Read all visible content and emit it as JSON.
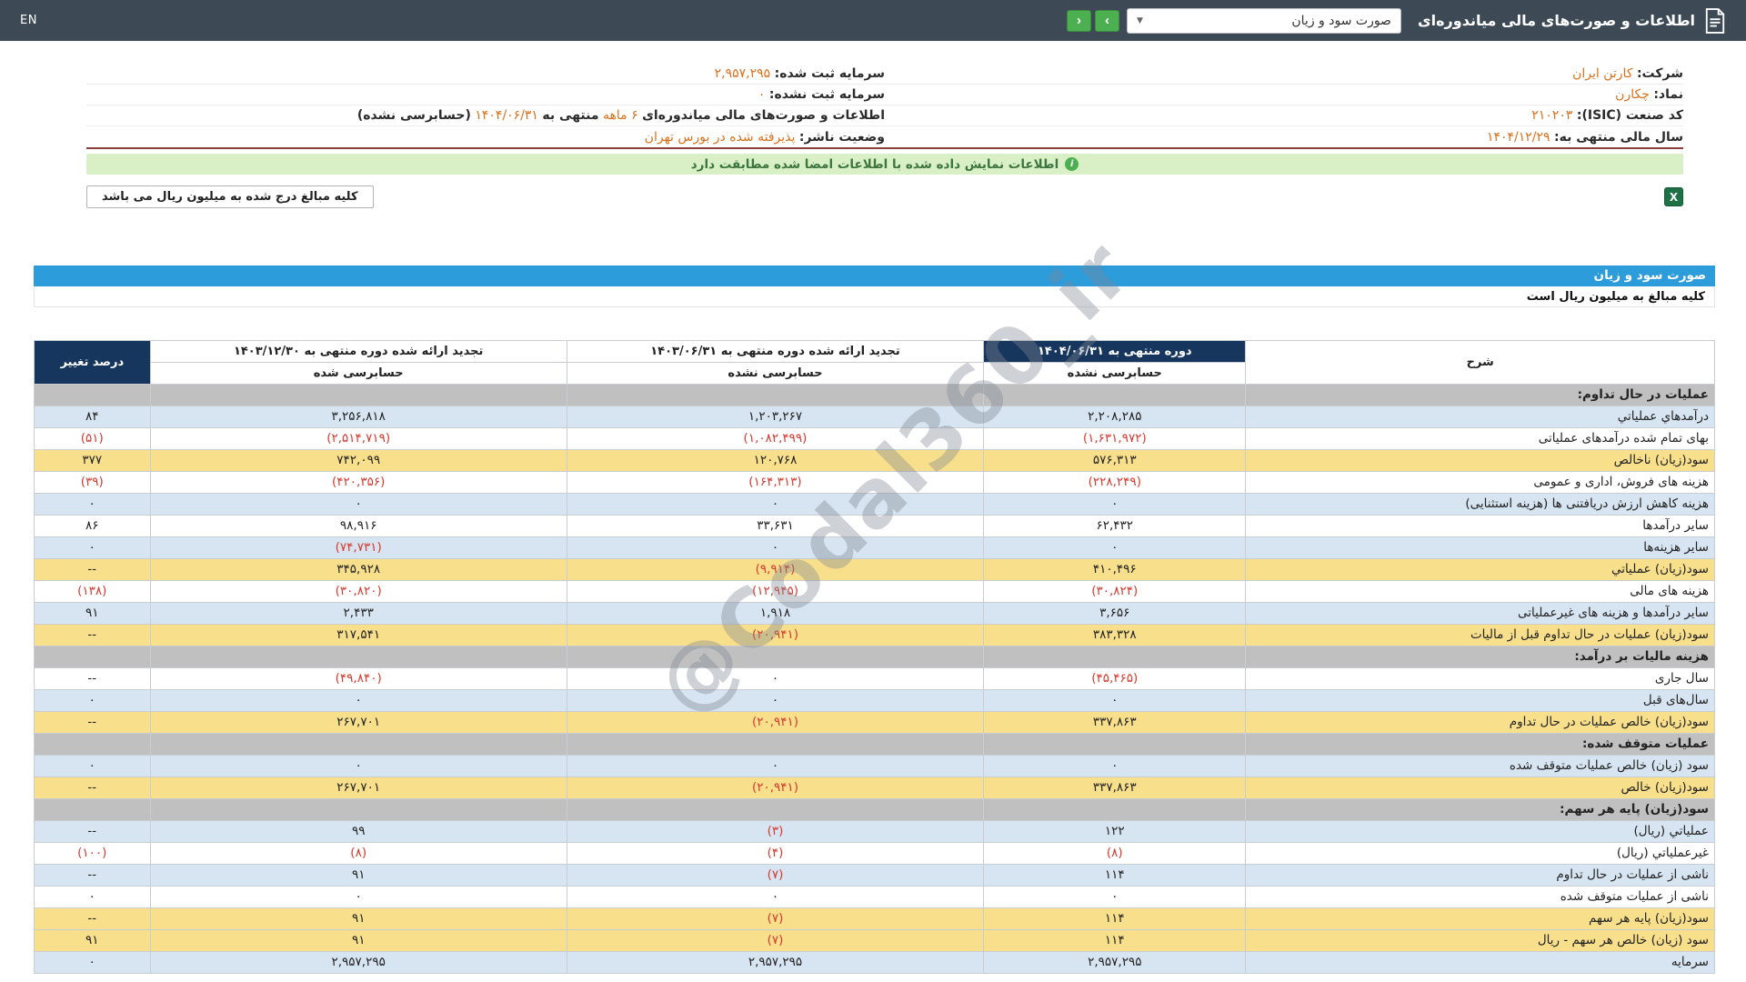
{
  "colors": {
    "topbar_bg": "#3d4a56",
    "accent_orange": "#d9711c",
    "nav_green": "#4caf50",
    "banner_bg": "#d9efc5",
    "banner_text": "#3c763d",
    "statement_bar_blue": "#2d9cdb",
    "header_navy": "#17365d",
    "row_blue": "#d7e4f1",
    "row_yellow": "#f8df8b",
    "section_gray": "#c0c0c0",
    "negative_red": "#d63a2f",
    "divider_red": "#8e3b3b",
    "excel_green": "#1e7145"
  },
  "topbar": {
    "title": "اطلاعات و صورت‌های مالی میاندوره‌ای",
    "dropdown_value": "صورت سود و زیان",
    "nav_forward": "›",
    "nav_back": "‹",
    "lang_label": "EN"
  },
  "icons": {
    "dropdown_caret": "▼",
    "info_icon": "i",
    "excel_letter": "X"
  },
  "company_info": {
    "company_label": "شرکت:",
    "company_value": "کارتن ایران",
    "registered_capital_label": "سرمایه ثبت شده:",
    "registered_capital_value": "۲,۹۵۷,۲۹۵",
    "symbol_label": "نماد:",
    "symbol_value": "چکارن",
    "unregistered_capital_label": "سرمایه ثبت نشده:",
    "unregistered_capital_value": "۰",
    "isic_label": "کد صنعت (ISIC):",
    "isic_value": "۲۱۰۲۰۳",
    "period_prefix": "اطلاعات و صورت‌های مالی میاندوره‌ای",
    "period_length": "۶ ماهه",
    "period_mid": "منتهی به",
    "period_date": "۱۴۰۴/۰۶/۳۱",
    "period_suffix": "(حسابرسی نشده)",
    "fiscal_year_label": "سال مالی منتهی به:",
    "fiscal_year_value": "۱۴۰۴/۱۲/۲۹",
    "publisher_status_label": "وضعیت ناشر:",
    "publisher_status_value": "پذیرفته شده در بورس تهران"
  },
  "banner": {
    "message": "اطلاعات نمایش داده شده با اطلاعات امضا شده مطابقت دارد"
  },
  "toolbar": {
    "unit_note": "کلیه مبالغ درج شده به میلیون ریال می باشد"
  },
  "statement": {
    "title": "صورت سود و زیان",
    "unit_note": "کلیه مبالغ به میلیون ریال است"
  },
  "watermark": "@Codal360_ir",
  "table": {
    "headers": {
      "col_desc": "شرح",
      "col_current": "دوره منتهی به ۱۴۰۴/۰۶/۳۱",
      "col_current_sub": "حسابرسی نشده",
      "col_prev_mid": "تجدید ارائه شده دوره منتهی به ۱۴۰۳/۰۶/۳۱",
      "col_prev_mid_sub": "حسابرسی نشده",
      "col_prev_year": "تجدید ارائه شده دوره منتهی به ۱۴۰۳/۱۲/۳۰",
      "col_prev_year_sub": "حسابرسی شده",
      "col_change": "درصد تغییر"
    },
    "rows": [
      {
        "type": "section",
        "label": "عملیات در حال تداوم:"
      },
      {
        "type": "data",
        "style": "blue",
        "label": "درآمدهاي عملياتي",
        "current": "۲,۲۰۸,۲۸۵",
        "prev_mid": "۱,۲۰۳,۲۶۷",
        "prev_year": "۳,۲۵۶,۸۱۸",
        "change": "۸۴"
      },
      {
        "type": "data",
        "style": "white",
        "label": "بهای تمام شده درآمدهای عملیاتی",
        "current": "(۱,۶۳۱,۹۷۲)",
        "prev_mid": "(۱,۰۸۲,۴۹۹)",
        "prev_year": "(۲,۵۱۴,۷۱۹)",
        "change": "(۵۱)"
      },
      {
        "type": "data",
        "style": "yellow",
        "label": "سود(زیان) ناخالص",
        "current": "۵۷۶,۳۱۳",
        "prev_mid": "۱۲۰,۷۶۸",
        "prev_year": "۷۴۲,۰۹۹",
        "change": "۳۷۷"
      },
      {
        "type": "data",
        "style": "white",
        "label": "هزینه های فروش، اداری و عمومی",
        "current": "(۲۲۸,۲۴۹)",
        "prev_mid": "(۱۶۴,۳۱۳)",
        "prev_year": "(۴۲۰,۳۵۶)",
        "change": "(۳۹)"
      },
      {
        "type": "data",
        "style": "blue",
        "label": "هزینه کاهش ارزش دریافتنی ها (هزینه استثنایی)",
        "current": "۰",
        "prev_mid": "۰",
        "prev_year": "۰",
        "change": "۰"
      },
      {
        "type": "data",
        "style": "white",
        "label": "سایر درآمدها",
        "current": "۶۲,۴۳۲",
        "prev_mid": "۳۳,۶۳۱",
        "prev_year": "۹۸,۹۱۶",
        "change": "۸۶"
      },
      {
        "type": "data",
        "style": "blue",
        "label": "سایر هزینه‌ها",
        "current": "۰",
        "prev_mid": "۰",
        "prev_year": "(۷۴,۷۳۱)",
        "change": "۰"
      },
      {
        "type": "data",
        "style": "yellow",
        "label": "سود(زیان) عملیاتي",
        "current": "۴۱۰,۴۹۶",
        "prev_mid": "(۹,۹۱۴)",
        "prev_year": "۳۴۵,۹۲۸",
        "change": "--"
      },
      {
        "type": "data",
        "style": "white",
        "label": "هزینه های مالی",
        "current": "(۳۰,۸۲۴)",
        "prev_mid": "(۱۲,۹۴۵)",
        "prev_year": "(۳۰,۸۲۰)",
        "change": "(۱۳۸)"
      },
      {
        "type": "data",
        "style": "blue",
        "label": "سایر درآمدها و هزینه های غیرعملیاتی",
        "current": "۳,۶۵۶",
        "prev_mid": "۱,۹۱۸",
        "prev_year": "۲,۴۳۳",
        "change": "۹۱"
      },
      {
        "type": "data",
        "style": "yellow",
        "label": "سود(زیان) عملیات در حال تداوم قبل از مالیات",
        "current": "۳۸۳,۳۲۸",
        "prev_mid": "(۲۰,۹۴۱)",
        "prev_year": "۳۱۷,۵۴۱",
        "change": "--"
      },
      {
        "type": "section",
        "label": "هزینه مالیات بر درآمد:"
      },
      {
        "type": "data",
        "style": "white",
        "label": "سال جاری",
        "current": "(۴۵,۴۶۵)",
        "prev_mid": "۰",
        "prev_year": "(۴۹,۸۴۰)",
        "change": "--"
      },
      {
        "type": "data",
        "style": "blue",
        "label": "سال‌های قبل",
        "current": "۰",
        "prev_mid": "۰",
        "prev_year": "۰",
        "change": "۰"
      },
      {
        "type": "data",
        "style": "yellow",
        "label": "سود(زیان) خالص عملیات در حال تداوم",
        "current": "۳۳۷,۸۶۳",
        "prev_mid": "(۲۰,۹۴۱)",
        "prev_year": "۲۶۷,۷۰۱",
        "change": "--"
      },
      {
        "type": "section",
        "label": "عملیات متوقف شده:"
      },
      {
        "type": "data",
        "style": "blue",
        "label": "سود (زیان) خالص عملیات متوقف شده",
        "current": "۰",
        "prev_mid": "۰",
        "prev_year": "۰",
        "change": "۰"
      },
      {
        "type": "data",
        "style": "yellow",
        "label": "سود(زیان) خالص",
        "current": "۳۳۷,۸۶۳",
        "prev_mid": "(۲۰,۹۴۱)",
        "prev_year": "۲۶۷,۷۰۱",
        "change": "--"
      },
      {
        "type": "section",
        "label": "سود(زیان) پایه هر سهم:"
      },
      {
        "type": "data",
        "style": "blue",
        "label": "عملیاتي (ریال)",
        "current": "۱۲۲",
        "prev_mid": "(۳)",
        "prev_year": "۹۹",
        "change": "--"
      },
      {
        "type": "data",
        "style": "white",
        "label": "غیرعملیاتي (ریال)",
        "current": "(۸)",
        "prev_mid": "(۴)",
        "prev_year": "(۸)",
        "change": "(۱۰۰)"
      },
      {
        "type": "data",
        "style": "blue",
        "label": "ناشی از عملیات در حال تداوم",
        "current": "۱۱۴",
        "prev_mid": "(۷)",
        "prev_year": "۹۱",
        "change": "--"
      },
      {
        "type": "data",
        "style": "white",
        "label": "ناشی از عملیات متوقف شده",
        "current": "۰",
        "prev_mid": "۰",
        "prev_year": "۰",
        "change": "۰"
      },
      {
        "type": "data",
        "style": "yellow",
        "label": "سود(زیان) پایه هر سهم",
        "current": "۱۱۴",
        "prev_mid": "(۷)",
        "prev_year": "۹۱",
        "change": "--"
      },
      {
        "type": "data",
        "style": "yellow",
        "label": "سود (زیان) خالص هر سهم - ریال",
        "current": "۱۱۴",
        "prev_mid": "(۷)",
        "prev_year": "۹۱",
        "change": "۹۱"
      },
      {
        "type": "data",
        "style": "blue",
        "label": "سرمایه",
        "current": "۲,۹۵۷,۲۹۵",
        "prev_mid": "۲,۹۵۷,۲۹۵",
        "prev_year": "۲,۹۵۷,۲۹۵",
        "change": "۰"
      }
    ]
  }
}
